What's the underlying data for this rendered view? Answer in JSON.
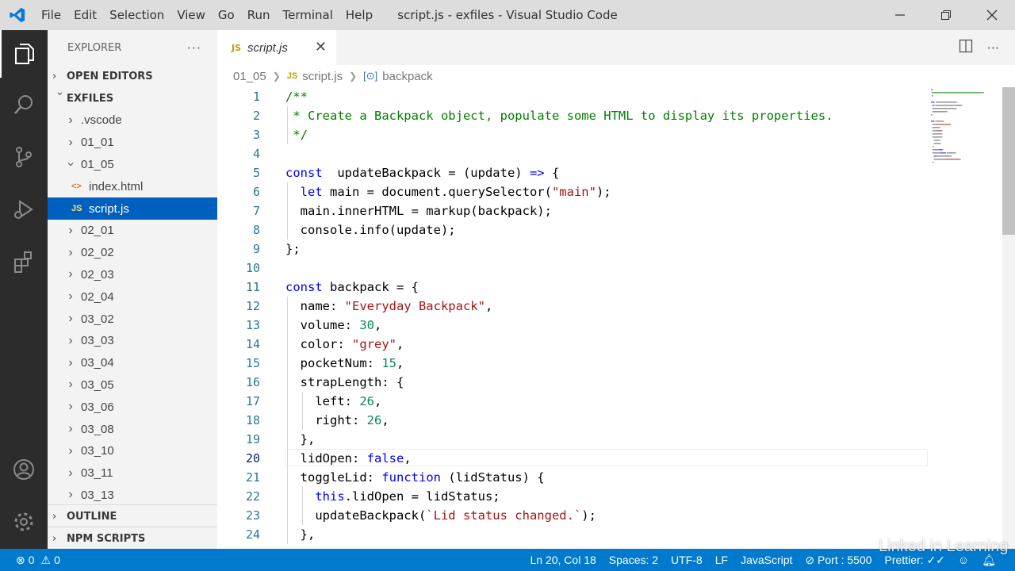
{
  "titlebar": {
    "menu": [
      "File",
      "Edit",
      "Selection",
      "View",
      "Go",
      "Run",
      "Terminal",
      "Help"
    ],
    "title": "script.js - exfiles - Visual Studio Code"
  },
  "explorer": {
    "header": "EXPLORER",
    "more": "···",
    "open_editors": "OPEN EDITORS",
    "root": "EXFILES",
    "tree": [
      {
        "label": ".vscode",
        "type": "folder",
        "expanded": false
      },
      {
        "label": "01_01",
        "type": "folder",
        "expanded": false
      },
      {
        "label": "01_05",
        "type": "folder",
        "expanded": true
      },
      {
        "label": "index.html",
        "type": "html-file"
      },
      {
        "label": "script.js",
        "type": "js-file",
        "selected": true
      },
      {
        "label": "02_01",
        "type": "folder",
        "expanded": false
      },
      {
        "label": "02_02",
        "type": "folder",
        "expanded": false
      },
      {
        "label": "02_03",
        "type": "folder",
        "expanded": false
      },
      {
        "label": "02_04",
        "type": "folder",
        "expanded": false
      },
      {
        "label": "03_02",
        "type": "folder",
        "expanded": false
      },
      {
        "label": "03_03",
        "type": "folder",
        "expanded": false
      },
      {
        "label": "03_04",
        "type": "folder",
        "expanded": false
      },
      {
        "label": "03_05",
        "type": "folder",
        "expanded": false
      },
      {
        "label": "03_06",
        "type": "folder",
        "expanded": false
      },
      {
        "label": "03_08",
        "type": "folder",
        "expanded": false
      },
      {
        "label": "03_10",
        "type": "folder",
        "expanded": false
      },
      {
        "label": "03_11",
        "type": "folder",
        "expanded": false
      },
      {
        "label": "03_13",
        "type": "folder",
        "expanded": false
      }
    ],
    "outline": "OUTLINE",
    "npm_scripts": "NPM SCRIPTS",
    "js_badge": "JS",
    "html_badge": "<>"
  },
  "editor": {
    "tab_badge": "JS",
    "tab_label": "script.js",
    "tab_close": "✕",
    "breadcrumb": [
      "01_05",
      "script.js",
      "backpack"
    ],
    "current_line": 20,
    "lines": [
      {
        "n": "1",
        "code": [
          [
            "cmt",
            "/**"
          ]
        ]
      },
      {
        "n": "2",
        "code": [
          [
            "cmt",
            " * Create a Backpack object, populate some HTML to display its properties."
          ]
        ]
      },
      {
        "n": "3",
        "code": [
          [
            "cmt",
            " */"
          ]
        ]
      },
      {
        "n": "4",
        "code": []
      },
      {
        "n": "5",
        "code": [
          [
            "kw",
            "const"
          ],
          [
            "",
            "  updateBackpack = (update) "
          ],
          [
            "kw",
            "=>"
          ],
          [
            "",
            " {"
          ]
        ]
      },
      {
        "n": "6",
        "code": [
          [
            "",
            "  "
          ],
          [
            "kw",
            "let"
          ],
          [
            "",
            " main = document.querySelector("
          ],
          [
            "str",
            "\"main\""
          ],
          [
            "",
            ");"
          ]
        ]
      },
      {
        "n": "7",
        "code": [
          [
            "",
            "  main.innerHTML = markup(backpack);"
          ]
        ]
      },
      {
        "n": "8",
        "code": [
          [
            "",
            "  console.info(update);"
          ]
        ]
      },
      {
        "n": "9",
        "code": [
          [
            "",
            "};"
          ]
        ]
      },
      {
        "n": "10",
        "code": []
      },
      {
        "n": "11",
        "code": [
          [
            "kw",
            "const"
          ],
          [
            "",
            " backpack = {"
          ]
        ]
      },
      {
        "n": "12",
        "code": [
          [
            "",
            "  name: "
          ],
          [
            "str",
            "\"Everyday Backpack\""
          ],
          [
            "",
            ","
          ]
        ]
      },
      {
        "n": "13",
        "code": [
          [
            "",
            "  volume: "
          ],
          [
            "num",
            "30"
          ],
          [
            "",
            ","
          ]
        ]
      },
      {
        "n": "14",
        "code": [
          [
            "",
            "  color: "
          ],
          [
            "str",
            "\"grey\""
          ],
          [
            "",
            ","
          ]
        ]
      },
      {
        "n": "15",
        "code": [
          [
            "",
            "  pocketNum: "
          ],
          [
            "num",
            "15"
          ],
          [
            "",
            ","
          ]
        ]
      },
      {
        "n": "16",
        "code": [
          [
            "",
            "  strapLength: {"
          ]
        ]
      },
      {
        "n": "17",
        "code": [
          [
            "",
            "    left: "
          ],
          [
            "num",
            "26"
          ],
          [
            "",
            ","
          ]
        ]
      },
      {
        "n": "18",
        "code": [
          [
            "",
            "    right: "
          ],
          [
            "num",
            "26"
          ],
          [
            "",
            ","
          ]
        ]
      },
      {
        "n": "19",
        "code": [
          [
            "",
            "  },"
          ]
        ]
      },
      {
        "n": "20",
        "code": [
          [
            "",
            "  lidOpen: "
          ],
          [
            "kw",
            "false"
          ],
          [
            "",
            ","
          ]
        ]
      },
      {
        "n": "21",
        "code": [
          [
            "",
            "  toggleLid: "
          ],
          [
            "kw",
            "function"
          ],
          [
            "",
            " (lidStatus) {"
          ]
        ]
      },
      {
        "n": "22",
        "code": [
          [
            "",
            "    "
          ],
          [
            "kw",
            "this"
          ],
          [
            "",
            ".lidOpen = lidStatus;"
          ]
        ]
      },
      {
        "n": "23",
        "code": [
          [
            "",
            "    updateBackpack("
          ],
          [
            "str",
            "`Lid status changed.`"
          ],
          [
            "",
            ");"
          ]
        ]
      },
      {
        "n": "24",
        "code": [
          [
            "",
            "  },"
          ]
        ]
      }
    ]
  },
  "statusbar": {
    "errors": "0",
    "warnings": "0",
    "position": "Ln 20, Col 18",
    "spaces": "Spaces: 2",
    "encoding": "UTF-8",
    "eol": "LF",
    "language": "JavaScript",
    "port": "Port : 5500",
    "prettier": "Prettier: ✓✓"
  },
  "watermark": "Linked in Learning",
  "colors": {
    "accent": "#007acc",
    "selection": "#0060c0",
    "keyword": "#0000ff",
    "string": "#a31515",
    "number": "#098658",
    "comment": "#008000"
  }
}
